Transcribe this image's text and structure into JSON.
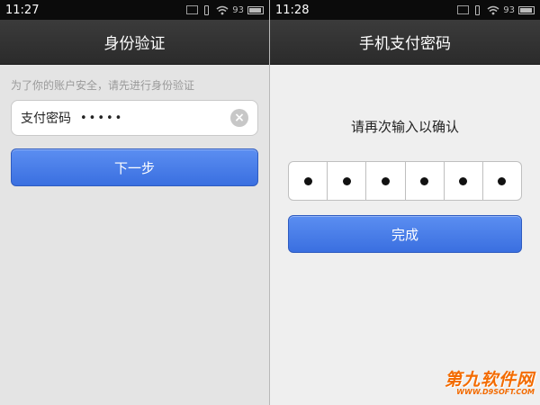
{
  "left": {
    "status_bar": {
      "time": "11:27",
      "battery": "93"
    },
    "title": "身份验证",
    "hint": "为了你的账户安全，请先进行身份验证",
    "password_field": {
      "label": "支付密码",
      "masked_value": "•••••"
    },
    "next_button_label": "下一步"
  },
  "right": {
    "status_bar": {
      "time": "11:28",
      "battery": "93"
    },
    "title": "手机支付密码",
    "prompt": "请再次输入以确认",
    "pin_digits_entered": 6,
    "done_button_label": "完成"
  },
  "watermark": {
    "main": "第九软件网",
    "sub": "WWW.D9SOFT.COM"
  },
  "colors": {
    "primary_button": "#4a7fe8",
    "title_bar": "#333333",
    "watermark": "#f36b00"
  }
}
